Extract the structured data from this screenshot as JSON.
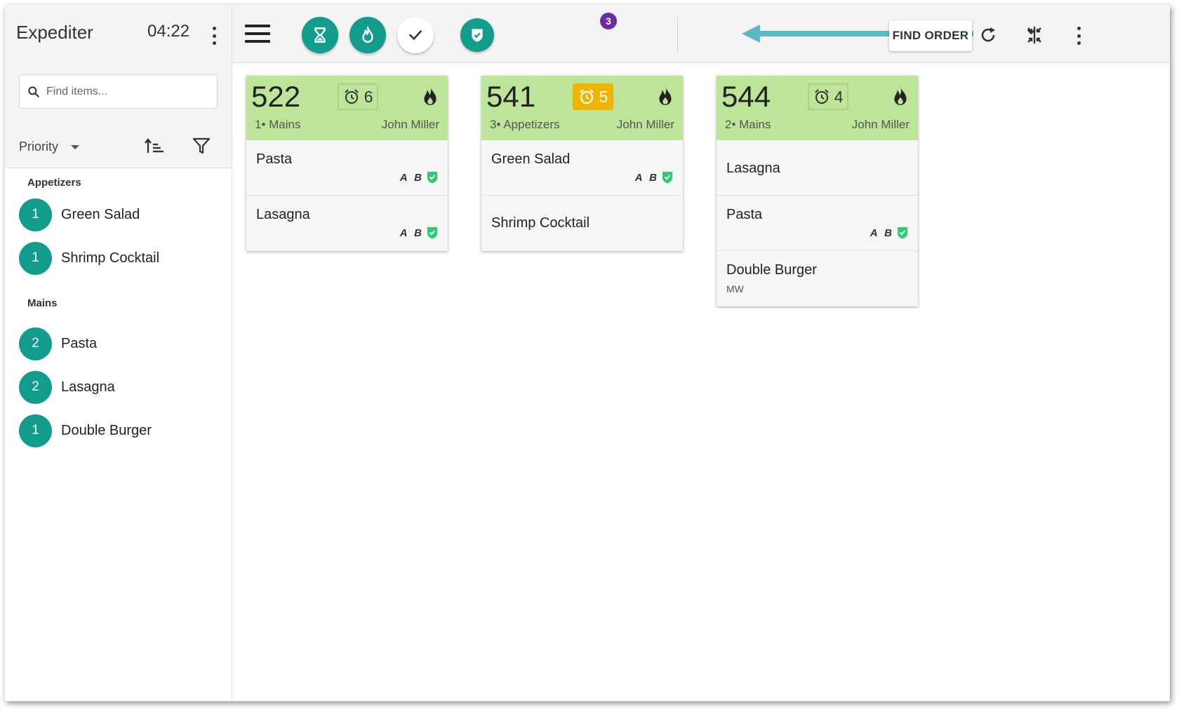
{
  "sidebar": {
    "title": "Expediter",
    "clock": "04:22",
    "search_placeholder": "Find items...",
    "sort_label": "Priority",
    "categories": [
      {
        "name": "Appetizers",
        "items": [
          {
            "count": "1",
            "label": "Green Salad"
          },
          {
            "count": "1",
            "label": "Shrimp Cocktail"
          }
        ]
      },
      {
        "name": "Mains",
        "items": [
          {
            "count": "2",
            "label": "Pasta"
          },
          {
            "count": "2",
            "label": "Lasagna"
          },
          {
            "count": "1",
            "label": "Double Burger"
          }
        ]
      }
    ]
  },
  "toolbar": {
    "fire_badge": "3",
    "find_order_label": "FIND ORDER"
  },
  "colors": {
    "teal": "#119c8c",
    "card_header": "#bde59a",
    "timer_warning": "#f0b400",
    "badge": "#6a2f9e",
    "check_green": "#2ecc71",
    "arrow": "#5ab8c4"
  },
  "orders": [
    {
      "number": "522",
      "timer": "6",
      "course": "1• Mains",
      "server": "John Miller",
      "items": [
        {
          "name": "Pasta",
          "tags": "A B"
        },
        {
          "name": "Lasagna",
          "tags": "A B"
        }
      ]
    },
    {
      "number": "541",
      "timer": "5",
      "course": "3• Appetizers",
      "server": "John Miller",
      "items": [
        {
          "name": "Green Salad",
          "tags": "A B"
        },
        {
          "name": "Shrimp Cocktail"
        }
      ]
    },
    {
      "number": "544",
      "timer": "4",
      "course": "2• Mains",
      "server": "John Miller",
      "items": [
        {
          "name": "Lasagna"
        },
        {
          "name": "Pasta",
          "tags": "A B"
        },
        {
          "name": "Double Burger",
          "modifier": "MW"
        }
      ]
    }
  ]
}
